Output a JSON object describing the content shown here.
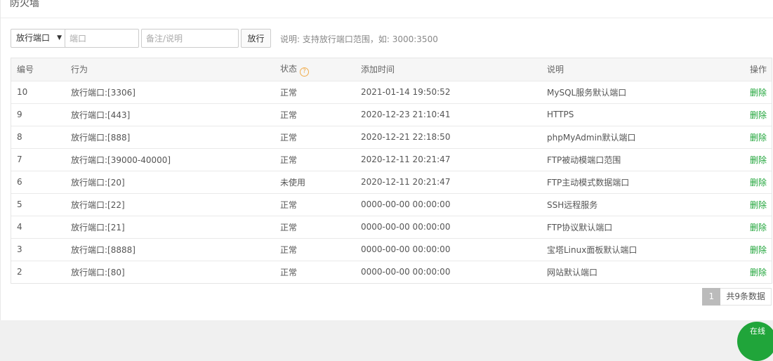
{
  "panel": {
    "title": "防火墙"
  },
  "toolbar": {
    "select_value": "放行端口",
    "port_placeholder": "端口",
    "remark_placeholder": "备注/说明",
    "submit_label": "放行",
    "hint": "说明: 支持放行端口范围，如: 3000:3500"
  },
  "table": {
    "headers": {
      "id": "编号",
      "action": "行为",
      "status": "状态",
      "time": "添加时间",
      "desc": "说明",
      "op": "操作"
    },
    "delete_label": "删除",
    "rows": [
      {
        "id": "10",
        "action": "放行端口:[3306]",
        "status": "正常",
        "time": "2021-01-14 19:50:52",
        "desc": "MySQL服务默认端口"
      },
      {
        "id": "9",
        "action": "放行端口:[443]",
        "status": "正常",
        "time": "2020-12-23 21:10:41",
        "desc": "HTTPS"
      },
      {
        "id": "8",
        "action": "放行端口:[888]",
        "status": "正常",
        "time": "2020-12-21 22:18:50",
        "desc": "phpMyAdmin默认端口"
      },
      {
        "id": "7",
        "action": "放行端口:[39000-40000]",
        "status": "正常",
        "time": "2020-12-11 20:21:47",
        "desc": "FTP被动模端口范围"
      },
      {
        "id": "6",
        "action": "放行端口:[20]",
        "status": "未使用",
        "time": "2020-12-11 20:21:47",
        "desc": "FTP主动模式数据端口"
      },
      {
        "id": "5",
        "action": "放行端口:[22]",
        "status": "正常",
        "time": "0000-00-00 00:00:00",
        "desc": "SSH远程服务"
      },
      {
        "id": "4",
        "action": "放行端口:[21]",
        "status": "正常",
        "time": "0000-00-00 00:00:00",
        "desc": "FTP协议默认端口"
      },
      {
        "id": "3",
        "action": "放行端口:[8888]",
        "status": "正常",
        "time": "0000-00-00 00:00:00",
        "desc": "宝塔Linux面板默认端口"
      },
      {
        "id": "2",
        "action": "放行端口:[80]",
        "status": "正常",
        "time": "0000-00-00 00:00:00",
        "desc": "网站默认端口"
      }
    ]
  },
  "pager": {
    "current": "1",
    "total_text": "共9条数据"
  },
  "fab": {
    "label": "在线"
  },
  "colors": {
    "accent_green": "#20a53a",
    "help_orange": "#f0ad4e"
  },
  "icons": {
    "status_help": "question-circle-icon",
    "select_arrow": "caret-down-icon"
  }
}
